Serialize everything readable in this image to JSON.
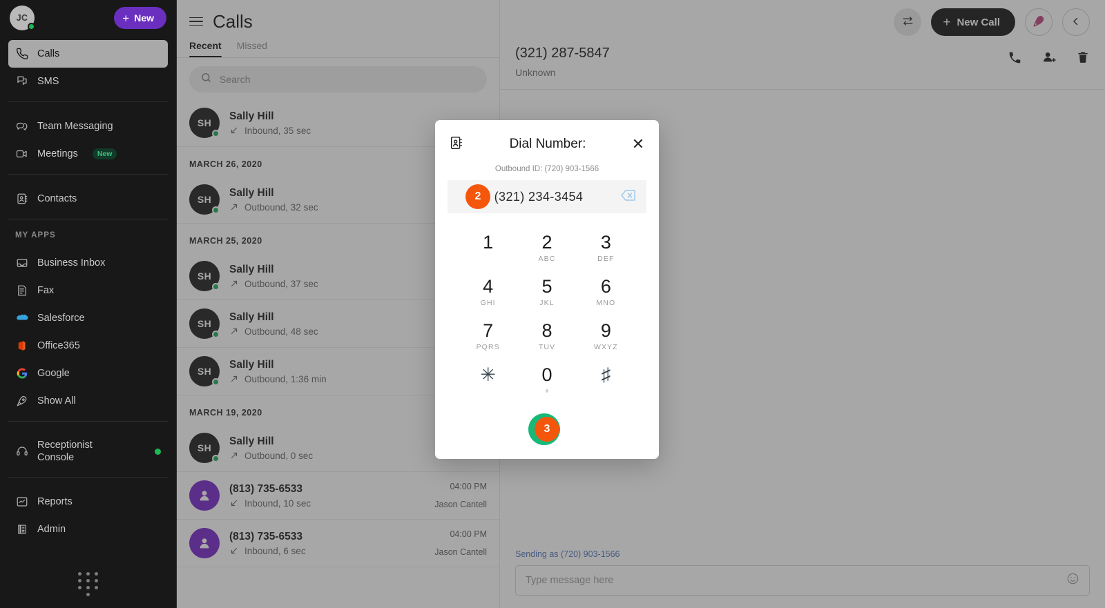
{
  "sidebar": {
    "avatar_initials": "JC",
    "new_button": "New",
    "primary_items": [
      {
        "label": "Calls",
        "icon": "phone-icon",
        "active": true
      },
      {
        "label": "SMS",
        "icon": "sms-icon",
        "active": false
      }
    ],
    "secondary_items": [
      {
        "label": "Team Messaging",
        "icon": "chat-icon"
      },
      {
        "label": "Meetings",
        "icon": "video-icon",
        "badge": "New"
      }
    ],
    "contacts_item": {
      "label": "Contacts",
      "icon": "contact-book-icon"
    },
    "my_apps_heading": "MY APPS",
    "apps": [
      {
        "label": "Business Inbox",
        "icon": "inbox-icon"
      },
      {
        "label": "Fax",
        "icon": "fax-icon"
      },
      {
        "label": "Salesforce",
        "icon": "salesforce-icon"
      },
      {
        "label": "Office365",
        "icon": "office365-icon"
      },
      {
        "label": "Google",
        "icon": "google-icon"
      },
      {
        "label": "Show All",
        "icon": "rocket-icon"
      }
    ],
    "receptionist": {
      "label": "Receptionist Console",
      "icon": "headset-icon",
      "status_color": "#1db954"
    },
    "footer_items": [
      {
        "label": "Reports",
        "icon": "chart-icon"
      },
      {
        "label": "Admin",
        "icon": "deskphone-icon"
      }
    ],
    "dialpad_icon": "dialpad-icon"
  },
  "header": {
    "title": "Calls",
    "menu_icon": "hamburger-icon",
    "tabs": [
      {
        "label": "Recent",
        "active": true
      },
      {
        "label": "Missed",
        "active": false
      }
    ]
  },
  "search": {
    "placeholder": "Search",
    "value": "",
    "icon": "search-icon"
  },
  "call_list": [
    {
      "type": "entry",
      "name": "Sally Hill",
      "initials": "SH",
      "avatar": "initials",
      "direction": "Inbound",
      "direction_icon": "arrow-inbound-icon",
      "detail": "Inbound, 35 sec",
      "time": "",
      "agent": "",
      "presence": true
    },
    {
      "type": "date",
      "label": "MARCH 26, 2020"
    },
    {
      "type": "entry",
      "name": "Sally Hill",
      "initials": "SH",
      "avatar": "initials",
      "direction": "Outbound",
      "direction_icon": "arrow-outbound-icon",
      "detail": "Outbound, 32 sec",
      "time": "",
      "agent": "",
      "presence": true
    },
    {
      "type": "date",
      "label": "MARCH 25, 2020"
    },
    {
      "type": "entry",
      "name": "Sally Hill",
      "initials": "SH",
      "avatar": "initials",
      "direction": "Outbound",
      "direction_icon": "arrow-outbound-icon",
      "detail": "Outbound, 37 sec",
      "time": "",
      "agent": "",
      "presence": true
    },
    {
      "type": "entry",
      "name": "Sally Hill",
      "initials": "SH",
      "avatar": "initials",
      "direction": "Outbound",
      "direction_icon": "arrow-outbound-icon",
      "detail": "Outbound, 48 sec",
      "time": "",
      "agent": "",
      "presence": true
    },
    {
      "type": "entry",
      "name": "Sally Hill",
      "initials": "SH",
      "avatar": "initials",
      "direction": "Outbound",
      "direction_icon": "arrow-outbound-icon",
      "detail": "Outbound, 1:36 min",
      "time": "",
      "agent": "",
      "presence": true
    },
    {
      "type": "date",
      "label": "MARCH 19, 2020"
    },
    {
      "type": "entry",
      "name": "Sally Hill",
      "initials": "SH",
      "avatar": "initials",
      "direction": "Outbound",
      "direction_icon": "arrow-outbound-icon",
      "detail": "Outbound, 0 sec",
      "time": "",
      "agent": "",
      "presence": true
    },
    {
      "type": "entry",
      "name": "(813) 735-6533",
      "initials": "",
      "avatar": "person",
      "direction": "Inbound",
      "direction_icon": "arrow-inbound-icon",
      "detail": "Inbound, 10 sec",
      "time": "04:00 PM",
      "agent": "Jason Cantell",
      "presence": false
    },
    {
      "type": "entry",
      "name": "(813) 735-6533",
      "initials": "",
      "avatar": "person",
      "direction": "Inbound",
      "direction_icon": "arrow-inbound-icon",
      "detail": "Inbound, 6 sec",
      "time": "04:00 PM",
      "agent": "Jason Cantell",
      "presence": false
    }
  ],
  "toolbar": {
    "transfer_icon": "transfer-icon",
    "new_call_label": "New Call",
    "rocket_icon": "rocket-icon",
    "collapse_icon": "chevron-left-icon"
  },
  "detail": {
    "number": "(321) 287-5847",
    "subtitle": "Unknown",
    "actions": [
      {
        "icon": "phone-icon",
        "name": "call-contact-button"
      },
      {
        "icon": "add-person-icon",
        "name": "add-contact-button"
      },
      {
        "icon": "trash-icon",
        "name": "delete-button"
      }
    ]
  },
  "composer": {
    "sending_as": "Sending as (720) 903-1566",
    "placeholder": "Type message here",
    "value": "",
    "emoji_icon": "emoji-icon"
  },
  "modal": {
    "title": "Dial Number:",
    "contacts_icon": "contact-book-icon",
    "close_icon": "close-icon",
    "outbound_id": "Outbound ID: (720) 903-1566",
    "dialed_number": "(321) 234-3454",
    "backspace_icon": "backspace-icon",
    "step_badge_input": "2",
    "step_badge_call": "3",
    "call_icon": "phone-icon",
    "keys": [
      {
        "digit": "1",
        "letters": ""
      },
      {
        "digit": "2",
        "letters": "ABC"
      },
      {
        "digit": "3",
        "letters": "DEF"
      },
      {
        "digit": "4",
        "letters": "GHI"
      },
      {
        "digit": "5",
        "letters": "JKL"
      },
      {
        "digit": "6",
        "letters": "MNO"
      },
      {
        "digit": "7",
        "letters": "PQRS"
      },
      {
        "digit": "8",
        "letters": "TUV"
      },
      {
        "digit": "9",
        "letters": "WXYZ"
      },
      {
        "digit": "✳",
        "letters": ""
      },
      {
        "digit": "0",
        "letters": "+"
      },
      {
        "digit": "♯",
        "letters": ""
      }
    ]
  },
  "colors": {
    "brand_purple": "#6b2fc0",
    "accent_orange": "#f4560c",
    "call_green": "#17b978",
    "presence_green": "#1db954",
    "link_blue": "#4f74b8"
  }
}
